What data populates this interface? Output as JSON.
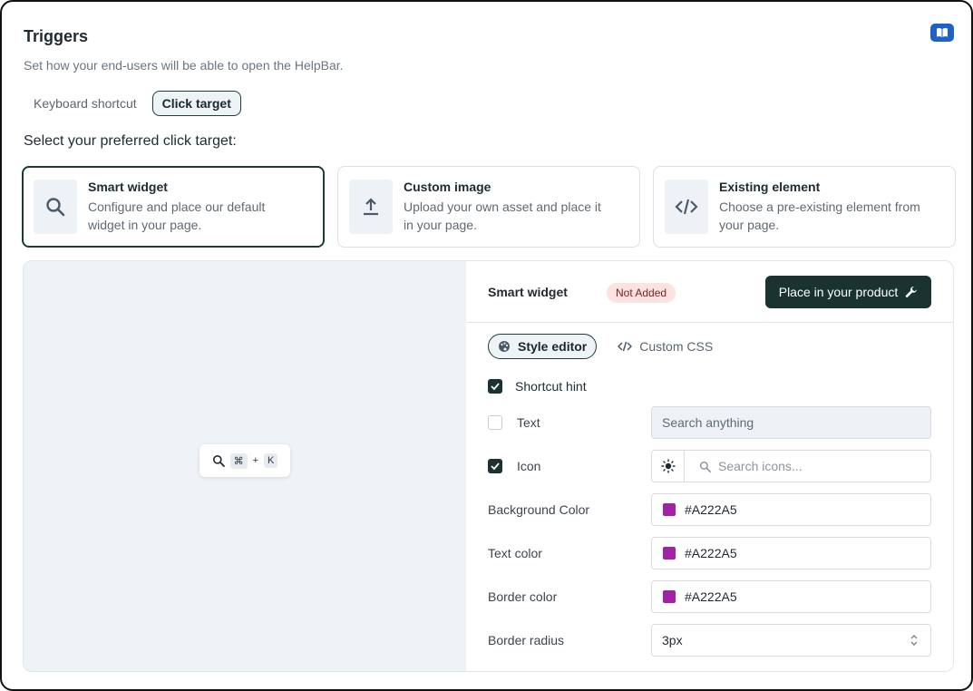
{
  "header": {
    "title": "Triggers",
    "subtitle": "Set how your end-users will be able to open the HelpBar."
  },
  "icons": {
    "docs": "book-icon",
    "search": "search-icon",
    "upload": "upload-icon",
    "code": "code-icon",
    "wrench": "wrench-icon",
    "palette": "palette-icon",
    "sun": "sun-icon",
    "chevrons": "chevron-up-down-icon"
  },
  "trigger_tabs": [
    {
      "label": "Keyboard shortcut",
      "active": false
    },
    {
      "label": "Click target",
      "active": true
    }
  ],
  "section_label": "Select your preferred click target:",
  "cards": [
    {
      "title": "Smart widget",
      "desc": "Configure and place our default widget in your page.",
      "selected": true
    },
    {
      "title": "Custom image",
      "desc": "Upload your own asset and place it in your page.",
      "selected": false
    },
    {
      "title": "Existing element",
      "desc": "Choose a pre-existing element from your page.",
      "selected": false
    }
  ],
  "preview": {
    "shortcut_key1": "⌘",
    "plus": "+",
    "shortcut_key2": "K"
  },
  "settings": {
    "title": "Smart widget",
    "status_badge": "Not Added",
    "place_button": "Place in your product",
    "tabs": [
      {
        "label": "Style editor",
        "active": true
      },
      {
        "label": "Custom CSS",
        "active": false
      }
    ],
    "shortcut_hint": {
      "label": "Shortcut hint",
      "checked": true
    },
    "text": {
      "label": "Text",
      "checked": false,
      "value": "Search anything"
    },
    "icon": {
      "label": "Icon",
      "checked": true,
      "placeholder": "Search icons..."
    },
    "background_color": {
      "label": "Background Color",
      "value": "#A222A5"
    },
    "text_color": {
      "label": "Text color",
      "value": "#A222A5"
    },
    "border_color": {
      "label": "Border color",
      "value": "#A222A5"
    },
    "border_radius": {
      "label": "Border radius",
      "value": "3px"
    }
  },
  "colors": {
    "accent_dark": "#1A3330",
    "docs_blue": "#1D62C4",
    "swatch": "#A222A5",
    "badge_bg": "#FDE2E2"
  }
}
